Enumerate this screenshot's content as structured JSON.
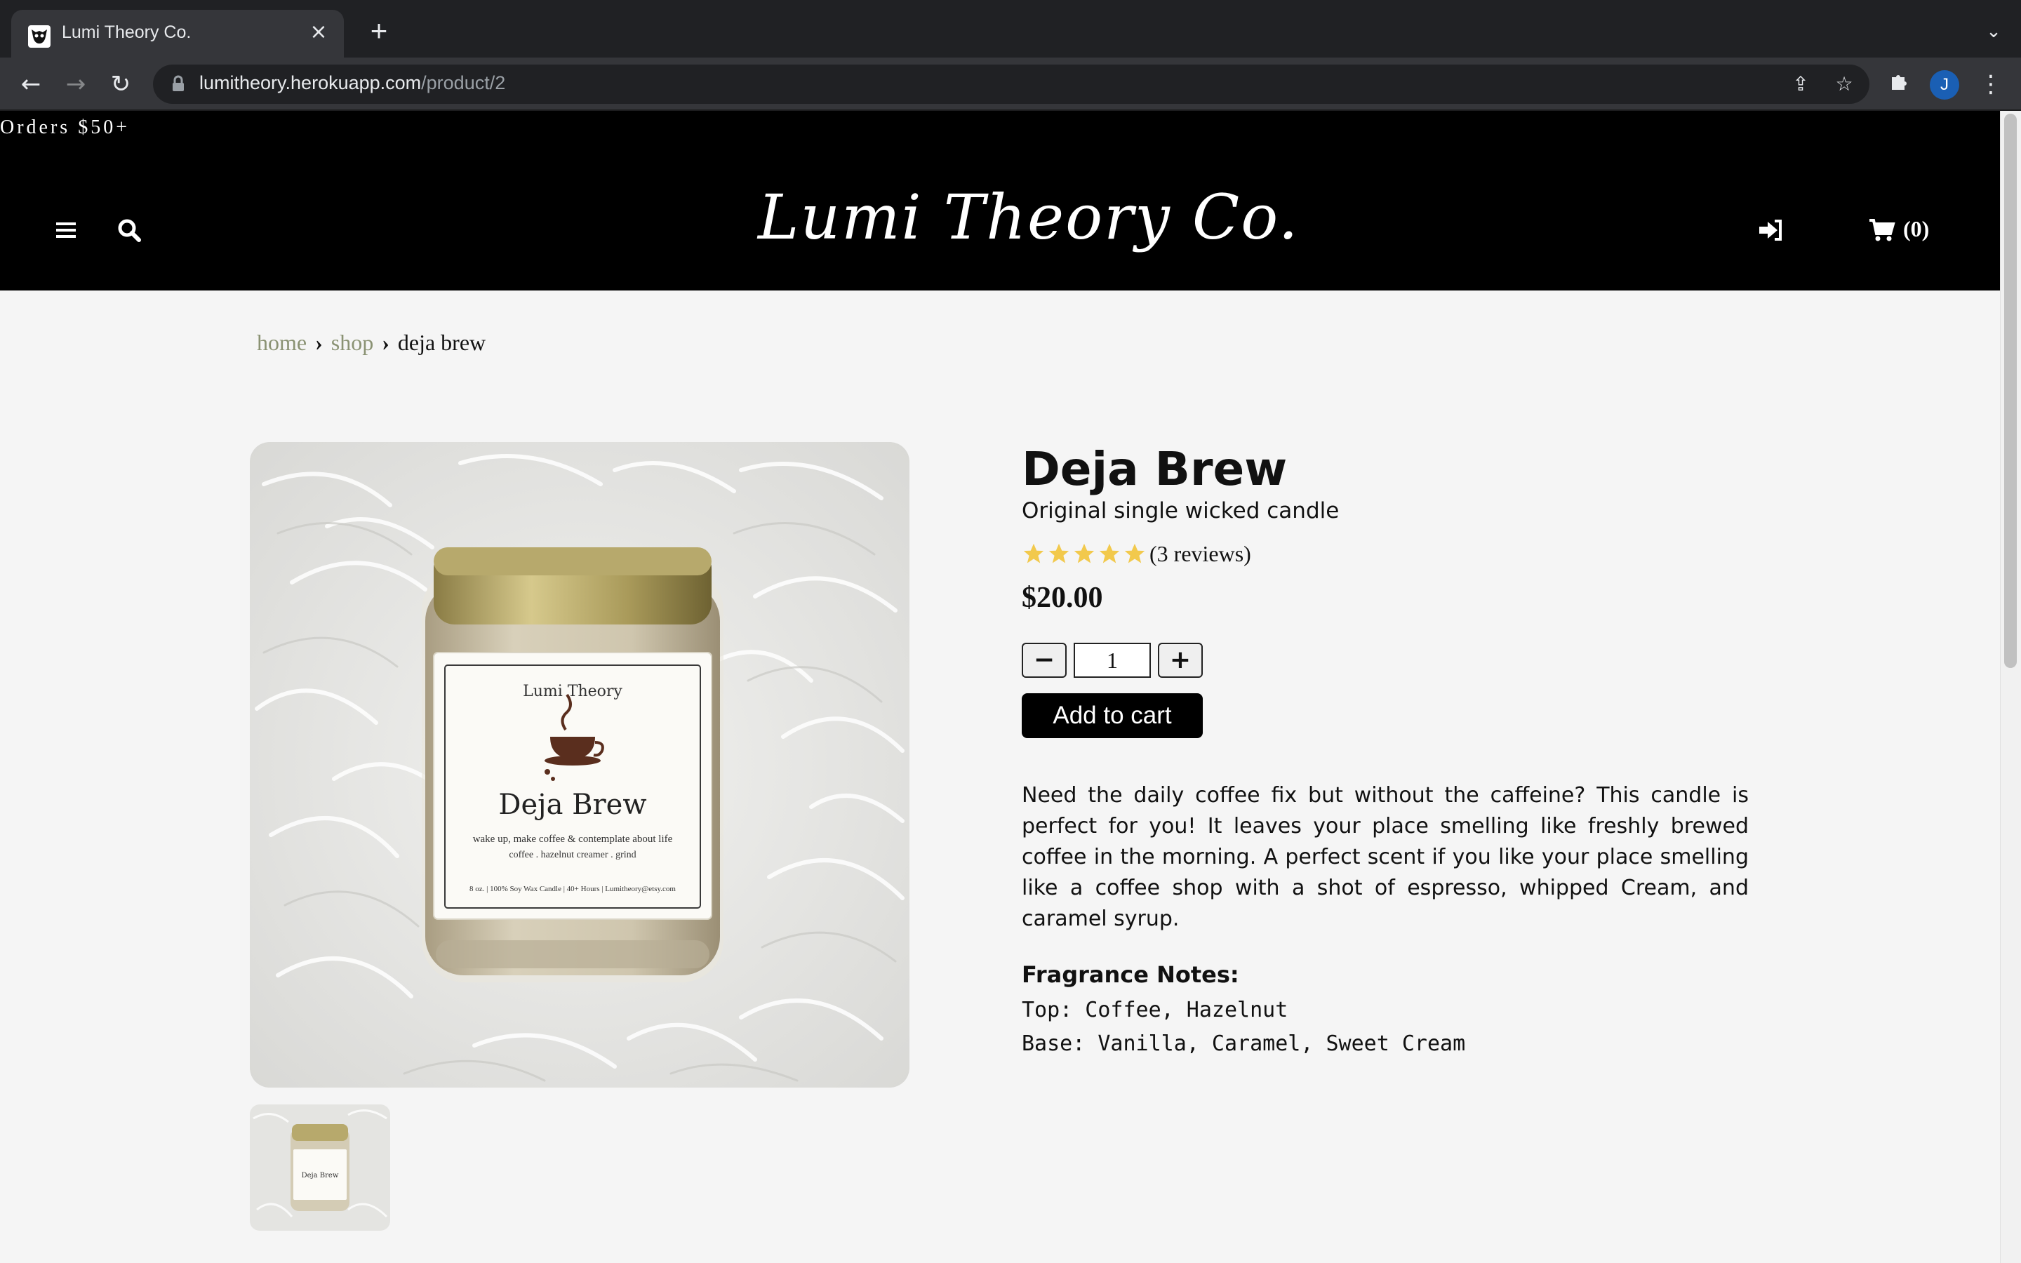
{
  "browser": {
    "tab_title": "Lumi Theory Co.",
    "url_host": "lumitheory.herokuapp.com",
    "url_path": "/product/2",
    "profile_initial": "J"
  },
  "header": {
    "promo_text": "Orders $50+",
    "logo_text": "Lumi Theory Co.",
    "cart_count": "(0)"
  },
  "breadcrumb": {
    "home": "home",
    "shop": "shop",
    "current": "deja brew"
  },
  "product": {
    "title": "Deja Brew",
    "subtitle": "Original single wicked candle",
    "rating": 5,
    "rating_max": 5,
    "reviews": "(3 reviews)",
    "price": "$20.00",
    "quantity": "1",
    "decrement_label": "−",
    "increment_label": "+",
    "add_to_cart_label": "Add to cart",
    "description": "Need the daily coffee fix but without the caffeine? This candle is perfect for you! It leaves your place smelling like freshly brewed coffee in the morning. A perfect scent if you like your place smelling like a coffee shop with a shot of espresso, whipped Cream, and caramel syrup.",
    "fragrance_heading": "Fragrance Notes:",
    "fragrance_top": "Top: Coffee, Hazelnut",
    "fragrance_base": "Base: Vanilla, Caramel, Sweet Cream"
  },
  "jar_label": {
    "brand": "Lumi Theory",
    "name": "Deja Brew",
    "tagline": "wake up, make coffee & contemplate about life",
    "notes": "coffee . hazelnut creamer . grind",
    "footer": "8 oz. | 100% Soy Wax Candle | 40+ Hours | Lumitheory@etsy.com"
  },
  "icons": {
    "menu": "hamburger-icon",
    "search": "search-icon",
    "login": "sign-in-icon",
    "cart": "shopping-cart-icon",
    "star": "star-icon"
  },
  "colors": {
    "star": "#f2c94c",
    "breadcrumb_link": "#8a9273",
    "header_bg": "#000000",
    "page_bg": "#f5f5f5"
  }
}
